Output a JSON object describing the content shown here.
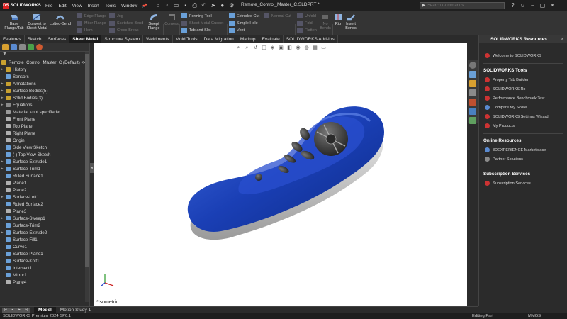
{
  "app": {
    "logo_text": "SOLIDWORKS",
    "document_title": "Remote_Control_Master_C.SLDPRT *"
  },
  "menu": [
    "File",
    "Edit",
    "View",
    "Insert",
    "Tools",
    "Window"
  ],
  "search": {
    "placeholder": "Search Commands"
  },
  "ribbon": {
    "big": [
      {
        "label": "Base\nFlange/Tab",
        "icon": "base-flange-icon"
      },
      {
        "label": "Convert to\nSheet Metal",
        "icon": "convert-sheet-metal-icon"
      },
      {
        "label": "Lofted-Bend",
        "icon": "lofted-bend-icon"
      },
      {
        "label": "Swept\nFlange",
        "icon": "swept-flange-icon"
      },
      {
        "label": "Corners",
        "icon": "corners-icon"
      },
      {
        "label": "Rip",
        "icon": "rip-icon"
      },
      {
        "label": "Insert\nBends",
        "icon": "insert-bends-icon"
      }
    ],
    "small_col1": [
      "Edge Flange",
      "Miter Flange",
      "Hem"
    ],
    "small_col2": [
      "Jog",
      "Sketched Bend",
      "Cross-Break"
    ],
    "small_col3": [
      "Forming Tool",
      "Sheet Metal Gusset",
      "Tab and Slot"
    ],
    "small_col4": [
      "Extruded Cut",
      "Simple Hole",
      "Vent"
    ],
    "small_col5": [
      "Normal Cut"
    ],
    "small_col6": [
      "Unfold",
      "Fold",
      "Flatten"
    ],
    "small_col7": [
      "No\nBends"
    ]
  },
  "tabs": [
    "Features",
    "Sketch",
    "Surfaces",
    "Sheet Metal",
    "Structure System",
    "Weldments",
    "Mold Tools",
    "Data Migration",
    "Markup",
    "Evaluate",
    "SOLIDWORKS Add-Ins"
  ],
  "active_tab": "Sheet Metal",
  "tree": {
    "root": "Remote_Control_Master_C (Default) <<",
    "items": [
      {
        "label": "History",
        "exp": "▸",
        "color": "#c8a030"
      },
      {
        "label": "Sensors",
        "exp": "",
        "color": "#6aa0d8"
      },
      {
        "label": "Annotations",
        "exp": "▸",
        "color": "#c8a030"
      },
      {
        "label": "Surface Bodies(5)",
        "exp": "▸",
        "color": "#c8a030"
      },
      {
        "label": "Solid Bodies(3)",
        "exp": "▸",
        "color": "#c8a030"
      },
      {
        "label": "Equations",
        "exp": "▸",
        "color": "#8a8a8a"
      },
      {
        "label": "Material <not specified>",
        "exp": "",
        "color": "#9a9a9a"
      },
      {
        "label": "Front Plane",
        "exp": "",
        "color": "#b0b0b0"
      },
      {
        "label": "Top Plane",
        "exp": "",
        "color": "#b0b0b0"
      },
      {
        "label": "Right Plane",
        "exp": "",
        "color": "#b0b0b0"
      },
      {
        "label": "Origin",
        "exp": "",
        "color": "#b0b0b0"
      },
      {
        "label": "Side View Sketch",
        "exp": "",
        "color": "#6aa0d8"
      },
      {
        "label": "(-) Top View Sketch",
        "exp": "",
        "color": "#6aa0d8"
      },
      {
        "label": "Surface-Extrude1",
        "exp": "▸",
        "color": "#6aa0d8"
      },
      {
        "label": "Surface-Trim1",
        "exp": "▸",
        "color": "#6aa0d8"
      },
      {
        "label": "Ruled Surface1",
        "exp": "",
        "color": "#6aa0d8"
      },
      {
        "label": "Plane1",
        "exp": "",
        "color": "#b0b0b0"
      },
      {
        "label": "Plane2",
        "exp": "",
        "color": "#b0b0b0"
      },
      {
        "label": "Surface-Loft1",
        "exp": "▸",
        "color": "#6aa0d8"
      },
      {
        "label": "Ruled Surface2",
        "exp": "",
        "color": "#6aa0d8"
      },
      {
        "label": "Plane3",
        "exp": "",
        "color": "#b0b0b0"
      },
      {
        "label": "Surface-Sweep1",
        "exp": "▸",
        "color": "#6aa0d8"
      },
      {
        "label": "Surface-Trim2",
        "exp": "",
        "color": "#6aa0d8"
      },
      {
        "label": "Surface-Extrude2",
        "exp": "▸",
        "color": "#6aa0d8"
      },
      {
        "label": "Surface-Fill1",
        "exp": "",
        "color": "#6aa0d8"
      },
      {
        "label": "Curve1",
        "exp": "",
        "color": "#6aa0d8"
      },
      {
        "label": "Surface-Plane1",
        "exp": "",
        "color": "#6aa0d8"
      },
      {
        "label": "Surface-Knit1",
        "exp": "",
        "color": "#6aa0d8"
      },
      {
        "label": "Intersect1",
        "exp": "",
        "color": "#6aa0d8"
      },
      {
        "label": "Mirror1",
        "exp": "",
        "color": "#6aa0d8"
      },
      {
        "label": "Plane4",
        "exp": "",
        "color": "#b0b0b0"
      }
    ]
  },
  "viewport": {
    "view_label": "*Isometric"
  },
  "resources": {
    "title": "SOLIDWORKS Resources",
    "welcome": "Welcome to SOLIDWORKS",
    "tools_title": "SOLIDWORKS Tools",
    "tools": [
      "Property Tab Builder",
      "SOLIDWORKS Rx",
      "Performance Benchmark Test",
      "Compare My Score",
      "SOLIDWORKS Settings Wizard",
      "My Products"
    ],
    "online_title": "Online Resources",
    "online": [
      "3DEXPERIENCE Marketplace",
      "Partner Solutions"
    ],
    "sub_title": "Subscription Services",
    "sub": [
      "Subscription Services"
    ]
  },
  "bottom_tabs": [
    "Model",
    "Motion Study 1"
  ],
  "status": {
    "left": "SOLIDWORKS Premium 2024 SP0.1",
    "mode": "Editing Part",
    "units": "MMGS"
  },
  "colors": {
    "body_blue": "#1f44b8",
    "body_grey": "#cfcfcf",
    "button_dark": "#3a3a3a"
  }
}
